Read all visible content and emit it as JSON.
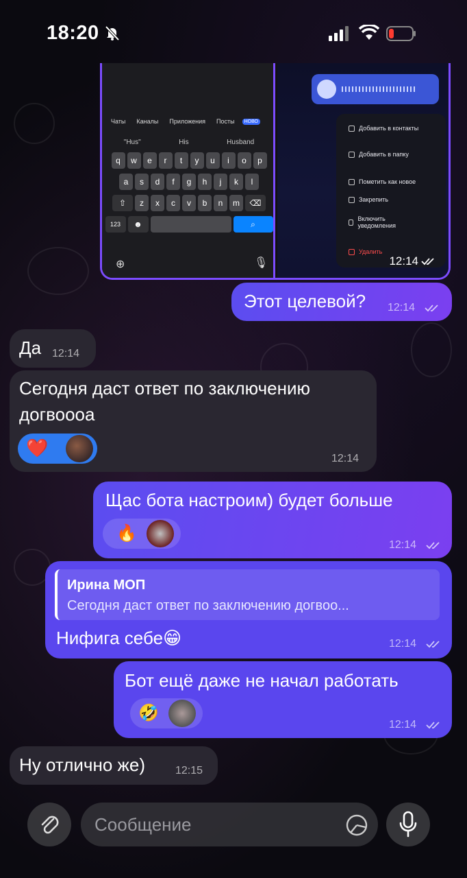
{
  "status_bar": {
    "time": "18:20"
  },
  "embedded_screenshot": {
    "tabs": [
      "Чаты",
      "Каналы",
      "Приложения",
      "Посты"
    ],
    "tab_badge": "НОВО",
    "suggestions": [
      "\"Hus\"",
      "His",
      "Husband"
    ],
    "keyboard": {
      "row1": [
        "q",
        "w",
        "e",
        "r",
        "t",
        "y",
        "u",
        "i",
        "o",
        "p"
      ],
      "row2": [
        "a",
        "s",
        "d",
        "f",
        "g",
        "h",
        "j",
        "k",
        "l"
      ],
      "row3": [
        "z",
        "x",
        "c",
        "v",
        "b",
        "n",
        "m"
      ],
      "numbers_key": "123"
    },
    "context_menu": [
      "Добавить в контакты",
      "Добавить в папку",
      "Пометить как новое",
      "Закрепить",
      "Включить уведомления",
      "Удалить"
    ],
    "time": "12:14"
  },
  "messages": [
    {
      "id": "m1",
      "direction": "out",
      "text": "Этот целевой?",
      "time": "12:14"
    },
    {
      "id": "m2",
      "direction": "in",
      "text": "Да",
      "time": "12:14"
    },
    {
      "id": "m3",
      "direction": "in",
      "text_line1": "Сегодня даст ответ по заключению",
      "text_line2": "догвоооа",
      "time": "12:14",
      "reaction": "❤️"
    },
    {
      "id": "m4",
      "direction": "out",
      "text": "Щас бота настроим) будет больше",
      "time": "12:14",
      "reaction": "🔥"
    },
    {
      "id": "m5",
      "direction": "out",
      "reply_to": {
        "name": "Ирина МОП",
        "text": "Сегодня даст ответ по заключению догвоо..."
      },
      "text": "Нифига себе😁",
      "time": "12:14"
    },
    {
      "id": "m6",
      "direction": "out",
      "text": "Бот ещё даже не начал работать",
      "time": "12:14",
      "reaction": "🤣"
    },
    {
      "id": "m7",
      "direction": "in",
      "text": "Ну отлично же)",
      "time": "12:15"
    }
  ],
  "composer": {
    "placeholder": "Сообщение"
  },
  "colors": {
    "outgoing": "#5a46ee",
    "incoming": "#2a2731",
    "accent": "#7c4cff"
  },
  "icons": [
    "bell-slash-icon",
    "signal-icon",
    "wifi-icon",
    "battery-low-icon",
    "paperclip-icon",
    "sticker-icon",
    "microphone-icon",
    "double-check-icon"
  ]
}
